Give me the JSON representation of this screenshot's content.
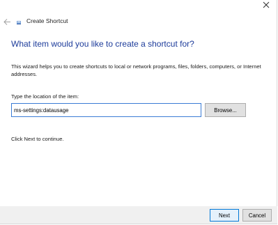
{
  "window": {
    "title": "Create Shortcut",
    "close_icon": "close-icon",
    "back_icon": "back-arrow-icon",
    "app_icon": "shortcut-icon"
  },
  "wizard": {
    "heading": "What item would you like to create a shortcut for?",
    "description": "This wizard helps you to create shortcuts to local or network programs, files, folders, computers, or Internet addresses.",
    "location_label": "Type the location of the item:",
    "location_value": "ms-settings:datausage",
    "browse_label": "Browse...",
    "hint": "Click Next to continue."
  },
  "footer": {
    "next_label": "Next",
    "cancel_label": "Cancel"
  },
  "colors": {
    "heading": "#1c3b9a",
    "input_border_focus": "#3a7bd5",
    "footer_bg": "#f0f0f0",
    "default_button_border": "#0078d7"
  }
}
